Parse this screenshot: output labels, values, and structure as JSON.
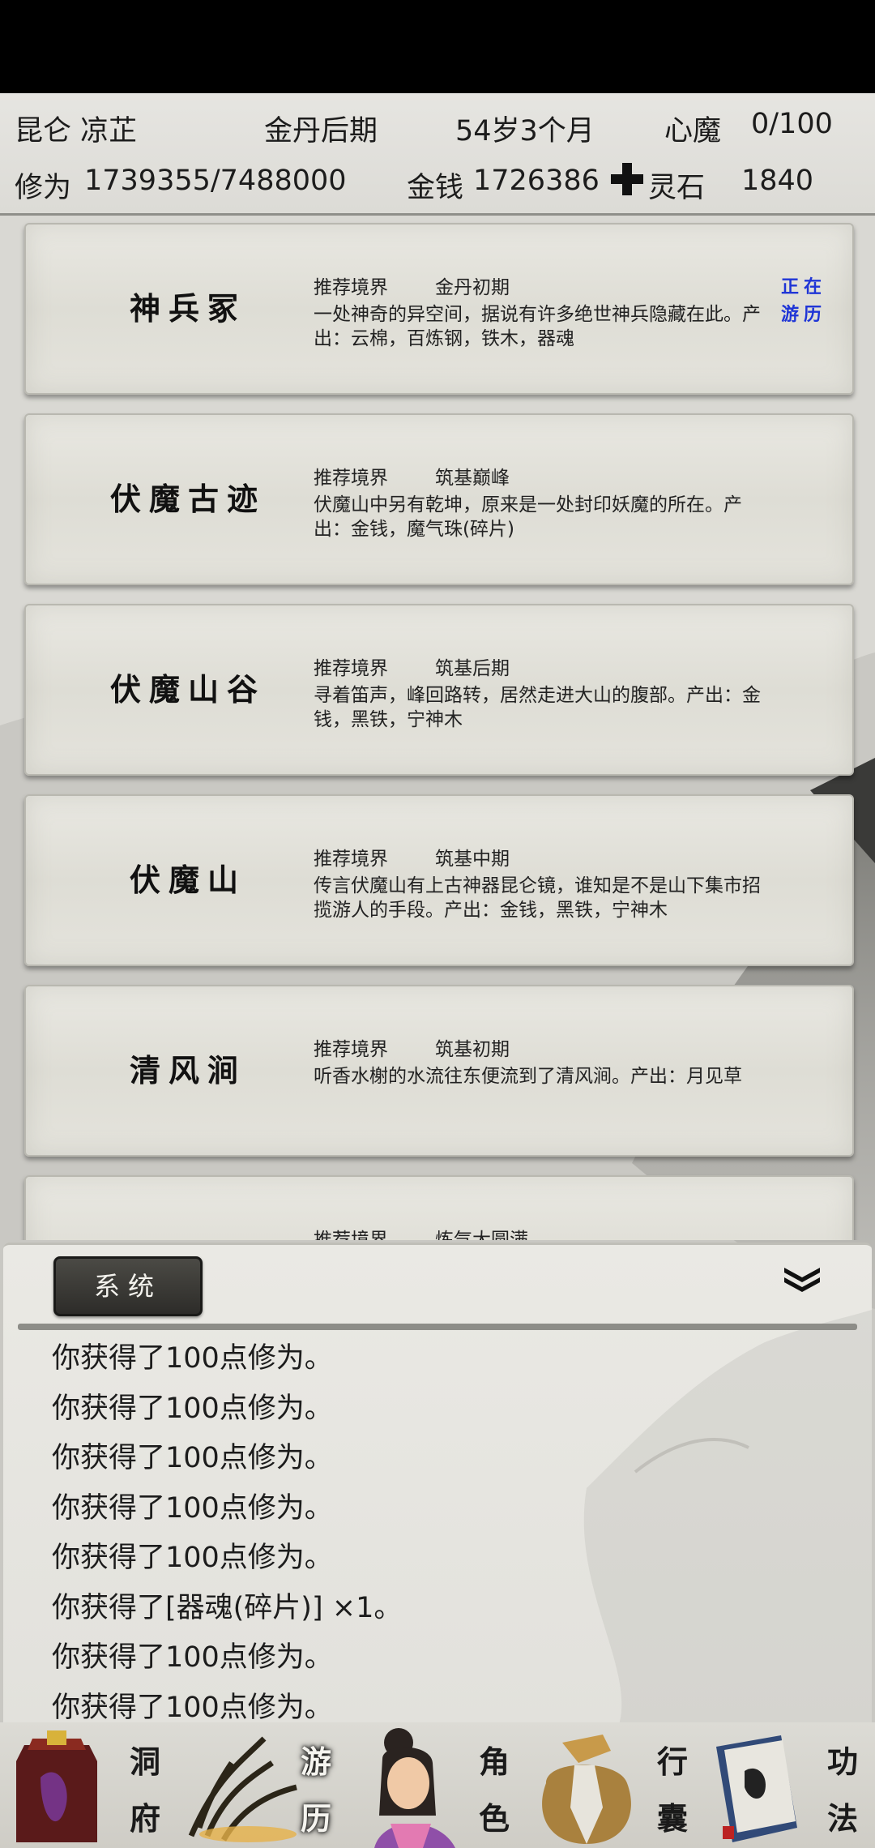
{
  "header": {
    "sect_name": "昆仑 凉芷",
    "realm": "金丹后期",
    "age": "54岁3个月",
    "heart_demon_label": "心魔",
    "heart_demon_value": "0/100",
    "cultivation_label": "修为",
    "cultivation_value": "1739355/7488000",
    "money_label": "金钱",
    "money_value": "1726386",
    "spirit_stone_label": "灵石",
    "spirit_stone_value": "1840"
  },
  "locations": [
    {
      "name": "神兵冢",
      "realm_label": "推荐境界",
      "realm": "金丹初期",
      "desc": "一处神奇的异空间，据说有许多绝世神兵隐藏在此。产出：云棉，百炼钢，铁木，器魂",
      "status": "正在游历"
    },
    {
      "name": "伏魔古迹",
      "realm_label": "推荐境界",
      "realm": "筑基巅峰",
      "desc": "伏魔山中另有乾坤，原来是一处封印妖魔的所在。产出：金钱，魔气珠(碎片)",
      "status": ""
    },
    {
      "name": "伏魔山谷",
      "realm_label": "推荐境界",
      "realm": "筑基后期",
      "desc": "寻着笛声，峰回路转，居然走进大山的腹部。产出：金钱，黑铁，宁神木",
      "status": ""
    },
    {
      "name": "伏魔山",
      "realm_label": "推荐境界",
      "realm": "筑基中期",
      "desc": "传言伏魔山有上古神器昆仑镜，谁知是不是山下集市招揽游人的手段。产出：金钱，黑铁，宁神木",
      "status": ""
    },
    {
      "name": "清风涧",
      "realm_label": "推荐境界",
      "realm": "筑基初期",
      "desc": "听香水榭的水流往东便流到了清风涧。产出：月见草",
      "status": ""
    },
    {
      "name": "",
      "realm_label": "推荐境界",
      "realm": "炼气大圆满",
      "desc": "",
      "status": ""
    }
  ],
  "log_panel": {
    "tab_label": "系统",
    "lines": [
      "你获得了100点修为。",
      "你获得了100点修为。",
      "你获得了100点修为。",
      "你获得了100点修为。",
      "你获得了100点修为。",
      "你获得了[器魂(碎片)] ×1。",
      "你获得了100点修为。",
      "你获得了100点修为。"
    ]
  },
  "nav": [
    {
      "top": "洞",
      "bottom": "府",
      "icon": "cave-mansion-icon"
    },
    {
      "top": "游",
      "bottom": "历",
      "icon": "travel-icon",
      "active": true
    },
    {
      "top": "角",
      "bottom": "色",
      "icon": "character-portrait-icon"
    },
    {
      "top": "行",
      "bottom": "囊",
      "icon": "bag-icon"
    },
    {
      "top": "功",
      "bottom": "法",
      "icon": "skill-book-icon"
    }
  ],
  "colors": {
    "status_text": "#1f35d6",
    "panel_tab": "#3a3935",
    "divider": "#8d8d88"
  }
}
